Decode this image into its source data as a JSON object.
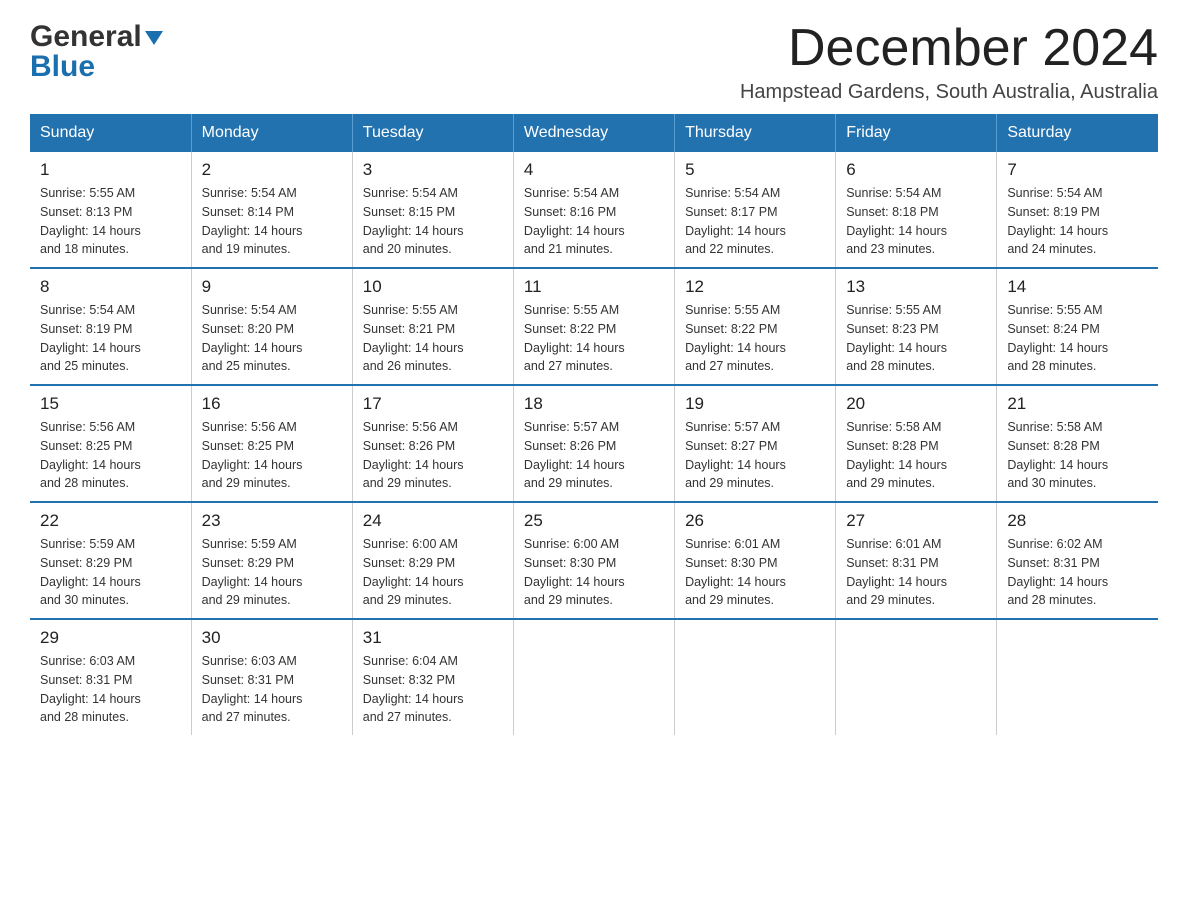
{
  "header": {
    "logo_general": "General",
    "logo_blue": "Blue",
    "month_year": "December 2024",
    "location": "Hampstead Gardens, South Australia, Australia"
  },
  "days_of_week": [
    "Sunday",
    "Monday",
    "Tuesday",
    "Wednesday",
    "Thursday",
    "Friday",
    "Saturday"
  ],
  "weeks": [
    [
      {
        "day": "1",
        "sunrise": "5:55 AM",
        "sunset": "8:13 PM",
        "daylight": "14 hours and 18 minutes."
      },
      {
        "day": "2",
        "sunrise": "5:54 AM",
        "sunset": "8:14 PM",
        "daylight": "14 hours and 19 minutes."
      },
      {
        "day": "3",
        "sunrise": "5:54 AM",
        "sunset": "8:15 PM",
        "daylight": "14 hours and 20 minutes."
      },
      {
        "day": "4",
        "sunrise": "5:54 AM",
        "sunset": "8:16 PM",
        "daylight": "14 hours and 21 minutes."
      },
      {
        "day": "5",
        "sunrise": "5:54 AM",
        "sunset": "8:17 PM",
        "daylight": "14 hours and 22 minutes."
      },
      {
        "day": "6",
        "sunrise": "5:54 AM",
        "sunset": "8:18 PM",
        "daylight": "14 hours and 23 minutes."
      },
      {
        "day": "7",
        "sunrise": "5:54 AM",
        "sunset": "8:19 PM",
        "daylight": "14 hours and 24 minutes."
      }
    ],
    [
      {
        "day": "8",
        "sunrise": "5:54 AM",
        "sunset": "8:19 PM",
        "daylight": "14 hours and 25 minutes."
      },
      {
        "day": "9",
        "sunrise": "5:54 AM",
        "sunset": "8:20 PM",
        "daylight": "14 hours and 25 minutes."
      },
      {
        "day": "10",
        "sunrise": "5:55 AM",
        "sunset": "8:21 PM",
        "daylight": "14 hours and 26 minutes."
      },
      {
        "day": "11",
        "sunrise": "5:55 AM",
        "sunset": "8:22 PM",
        "daylight": "14 hours and 27 minutes."
      },
      {
        "day": "12",
        "sunrise": "5:55 AM",
        "sunset": "8:22 PM",
        "daylight": "14 hours and 27 minutes."
      },
      {
        "day": "13",
        "sunrise": "5:55 AM",
        "sunset": "8:23 PM",
        "daylight": "14 hours and 28 minutes."
      },
      {
        "day": "14",
        "sunrise": "5:55 AM",
        "sunset": "8:24 PM",
        "daylight": "14 hours and 28 minutes."
      }
    ],
    [
      {
        "day": "15",
        "sunrise": "5:56 AM",
        "sunset": "8:25 PM",
        "daylight": "14 hours and 28 minutes."
      },
      {
        "day": "16",
        "sunrise": "5:56 AM",
        "sunset": "8:25 PM",
        "daylight": "14 hours and 29 minutes."
      },
      {
        "day": "17",
        "sunrise": "5:56 AM",
        "sunset": "8:26 PM",
        "daylight": "14 hours and 29 minutes."
      },
      {
        "day": "18",
        "sunrise": "5:57 AM",
        "sunset": "8:26 PM",
        "daylight": "14 hours and 29 minutes."
      },
      {
        "day": "19",
        "sunrise": "5:57 AM",
        "sunset": "8:27 PM",
        "daylight": "14 hours and 29 minutes."
      },
      {
        "day": "20",
        "sunrise": "5:58 AM",
        "sunset": "8:28 PM",
        "daylight": "14 hours and 29 minutes."
      },
      {
        "day": "21",
        "sunrise": "5:58 AM",
        "sunset": "8:28 PM",
        "daylight": "14 hours and 30 minutes."
      }
    ],
    [
      {
        "day": "22",
        "sunrise": "5:59 AM",
        "sunset": "8:29 PM",
        "daylight": "14 hours and 30 minutes."
      },
      {
        "day": "23",
        "sunrise": "5:59 AM",
        "sunset": "8:29 PM",
        "daylight": "14 hours and 29 minutes."
      },
      {
        "day": "24",
        "sunrise": "6:00 AM",
        "sunset": "8:29 PM",
        "daylight": "14 hours and 29 minutes."
      },
      {
        "day": "25",
        "sunrise": "6:00 AM",
        "sunset": "8:30 PM",
        "daylight": "14 hours and 29 minutes."
      },
      {
        "day": "26",
        "sunrise": "6:01 AM",
        "sunset": "8:30 PM",
        "daylight": "14 hours and 29 minutes."
      },
      {
        "day": "27",
        "sunrise": "6:01 AM",
        "sunset": "8:31 PM",
        "daylight": "14 hours and 29 minutes."
      },
      {
        "day": "28",
        "sunrise": "6:02 AM",
        "sunset": "8:31 PM",
        "daylight": "14 hours and 28 minutes."
      }
    ],
    [
      {
        "day": "29",
        "sunrise": "6:03 AM",
        "sunset": "8:31 PM",
        "daylight": "14 hours and 28 minutes."
      },
      {
        "day": "30",
        "sunrise": "6:03 AM",
        "sunset": "8:31 PM",
        "daylight": "14 hours and 27 minutes."
      },
      {
        "day": "31",
        "sunrise": "6:04 AM",
        "sunset": "8:32 PM",
        "daylight": "14 hours and 27 minutes."
      },
      null,
      null,
      null,
      null
    ]
  ],
  "labels": {
    "sunrise": "Sunrise:",
    "sunset": "Sunset:",
    "daylight": "Daylight:"
  }
}
